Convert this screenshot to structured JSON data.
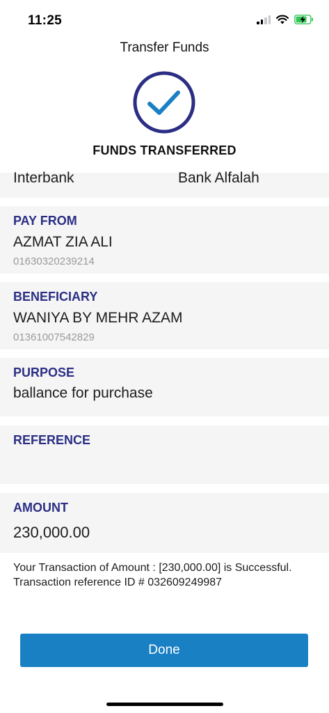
{
  "status_bar": {
    "time": "11:25",
    "signal_icon": "cellular-signal-icon",
    "wifi_icon": "wifi-icon",
    "battery_icon": "battery-charging-icon",
    "battery_color": "#34c759"
  },
  "header": {
    "title": "Transfer Funds"
  },
  "result": {
    "icon": "check-circle-icon",
    "icon_ring_color": "#2b2e84",
    "icon_check_color": "#1a80c4",
    "heading": "FUNDS TRANSFERRED"
  },
  "transfer_type": {
    "type": "Interbank",
    "bank": "Bank Alfalah"
  },
  "pay_from": {
    "label": "PAY FROM",
    "name": "AZMAT ZIA ALI",
    "account": "01630320239214"
  },
  "beneficiary": {
    "label": "BENEFICIARY",
    "name": "WANIYA BY MEHR AZAM",
    "account": "01361007542829"
  },
  "purpose": {
    "label": "PURPOSE",
    "value": "ballance for purchase"
  },
  "reference": {
    "label": "REFERENCE",
    "value": ""
  },
  "amount": {
    "label": "AMOUNT",
    "value": "230,000.00"
  },
  "message": "Your Transaction of Amount : [230,000.00] is Successful. Transaction reference ID # 032609249987",
  "actions": {
    "done_label": "Done",
    "accent_color": "#1a80c4"
  }
}
